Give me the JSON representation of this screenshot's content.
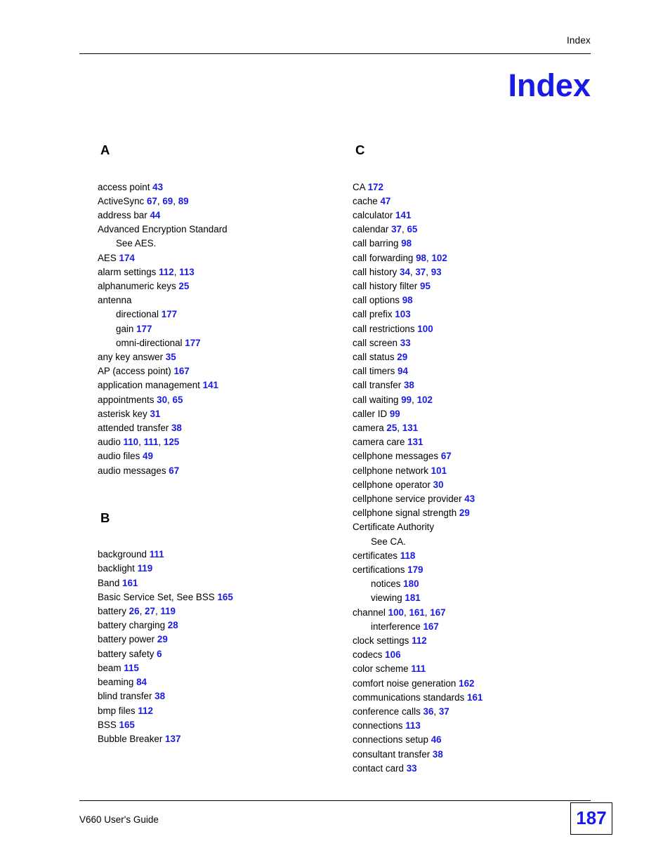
{
  "header": {
    "running_head": "Index"
  },
  "title": "Index",
  "footer": {
    "guide_name": "V660 User's Guide",
    "page_number": "187"
  },
  "columns": [
    {
      "sections": [
        {
          "letter": "A",
          "entries": [
            {
              "text": "access point",
              "pages": [
                "43"
              ],
              "sub": false
            },
            {
              "text": "ActiveSync",
              "pages": [
                "67",
                "69",
                "89"
              ],
              "sub": false
            },
            {
              "text": "address bar",
              "pages": [
                "44"
              ],
              "sub": false
            },
            {
              "text": "Advanced Encryption Standard",
              "pages": [],
              "sub": false
            },
            {
              "text": "See AES.",
              "pages": [],
              "sub": true
            },
            {
              "text": "AES",
              "pages": [
                "174"
              ],
              "sub": false
            },
            {
              "text": "alarm settings",
              "pages": [
                "112",
                "113"
              ],
              "sub": false
            },
            {
              "text": "alphanumeric keys",
              "pages": [
                "25"
              ],
              "sub": false
            },
            {
              "text": "antenna",
              "pages": [],
              "sub": false
            },
            {
              "text": "directional",
              "pages": [
                "177"
              ],
              "sub": true
            },
            {
              "text": "gain",
              "pages": [
                "177"
              ],
              "sub": true
            },
            {
              "text": "omni-directional",
              "pages": [
                "177"
              ],
              "sub": true
            },
            {
              "text": "any key answer",
              "pages": [
                "35"
              ],
              "sub": false
            },
            {
              "text": "AP (access point)",
              "pages": [
                "167"
              ],
              "sub": false
            },
            {
              "text": "application management",
              "pages": [
                "141"
              ],
              "sub": false
            },
            {
              "text": "appointments",
              "pages": [
                "30",
                "65"
              ],
              "sub": false
            },
            {
              "text": "asterisk key",
              "pages": [
                "31"
              ],
              "sub": false
            },
            {
              "text": "attended transfer",
              "pages": [
                "38"
              ],
              "sub": false
            },
            {
              "text": "audio",
              "pages": [
                "110",
                "111",
                "125"
              ],
              "sub": false
            },
            {
              "text": "audio files",
              "pages": [
                "49"
              ],
              "sub": false
            },
            {
              "text": "audio messages",
              "pages": [
                "67"
              ],
              "sub": false
            }
          ]
        },
        {
          "letter": "B",
          "entries": [
            {
              "text": "background",
              "pages": [
                "111"
              ],
              "sub": false
            },
            {
              "text": "backlight",
              "pages": [
                "119"
              ],
              "sub": false
            },
            {
              "text": "Band",
              "pages": [
                "161"
              ],
              "sub": false
            },
            {
              "text": "Basic Service Set, See BSS",
              "pages": [
                "165"
              ],
              "sub": false
            },
            {
              "text": "battery",
              "pages": [
                "26",
                "27",
                "119"
              ],
              "sub": false
            },
            {
              "text": "battery charging",
              "pages": [
                "28"
              ],
              "sub": false
            },
            {
              "text": "battery power",
              "pages": [
                "29"
              ],
              "sub": false
            },
            {
              "text": "battery safety",
              "pages": [
                "6"
              ],
              "sub": false
            },
            {
              "text": "beam",
              "pages": [
                "115"
              ],
              "sub": false
            },
            {
              "text": "beaming",
              "pages": [
                "84"
              ],
              "sub": false
            },
            {
              "text": "blind transfer",
              "pages": [
                "38"
              ],
              "sub": false
            },
            {
              "text": "bmp files",
              "pages": [
                "112"
              ],
              "sub": false
            },
            {
              "text": "BSS",
              "pages": [
                "165"
              ],
              "sub": false
            },
            {
              "text": "Bubble Breaker",
              "pages": [
                "137"
              ],
              "sub": false
            }
          ]
        }
      ]
    },
    {
      "sections": [
        {
          "letter": "C",
          "entries": [
            {
              "text": "CA",
              "pages": [
                "172"
              ],
              "sub": false
            },
            {
              "text": "cache",
              "pages": [
                "47"
              ],
              "sub": false
            },
            {
              "text": "calculator",
              "pages": [
                "141"
              ],
              "sub": false
            },
            {
              "text": "calendar",
              "pages": [
                "37",
                "65"
              ],
              "sub": false
            },
            {
              "text": "call barring",
              "pages": [
                "98"
              ],
              "sub": false
            },
            {
              "text": "call forwarding",
              "pages": [
                "98",
                "102"
              ],
              "sub": false
            },
            {
              "text": "call history",
              "pages": [
                "34",
                "37",
                "93"
              ],
              "sub": false
            },
            {
              "text": "call history filter",
              "pages": [
                "95"
              ],
              "sub": false
            },
            {
              "text": "call options",
              "pages": [
                "98"
              ],
              "sub": false
            },
            {
              "text": "call prefix",
              "pages": [
                "103"
              ],
              "sub": false
            },
            {
              "text": "call restrictions",
              "pages": [
                "100"
              ],
              "sub": false
            },
            {
              "text": "call screen",
              "pages": [
                "33"
              ],
              "sub": false
            },
            {
              "text": "call status",
              "pages": [
                "29"
              ],
              "sub": false
            },
            {
              "text": "call timers",
              "pages": [
                "94"
              ],
              "sub": false
            },
            {
              "text": "call transfer",
              "pages": [
                "38"
              ],
              "sub": false
            },
            {
              "text": "call waiting",
              "pages": [
                "99",
                "102"
              ],
              "sub": false
            },
            {
              "text": "caller ID",
              "pages": [
                "99"
              ],
              "sub": false
            },
            {
              "text": "camera",
              "pages": [
                "25",
                "131"
              ],
              "sub": false
            },
            {
              "text": "camera care",
              "pages": [
                "131"
              ],
              "sub": false
            },
            {
              "text": "cellphone messages",
              "pages": [
                "67"
              ],
              "sub": false
            },
            {
              "text": "cellphone network",
              "pages": [
                "101"
              ],
              "sub": false
            },
            {
              "text": "cellphone operator",
              "pages": [
                "30"
              ],
              "sub": false
            },
            {
              "text": "cellphone service provider",
              "pages": [
                "43"
              ],
              "sub": false
            },
            {
              "text": "cellphone signal strength",
              "pages": [
                "29"
              ],
              "sub": false
            },
            {
              "text": "Certificate Authority",
              "pages": [],
              "sub": false
            },
            {
              "text": "See CA.",
              "pages": [],
              "sub": true
            },
            {
              "text": "certificates",
              "pages": [
                "118"
              ],
              "sub": false
            },
            {
              "text": "certifications",
              "pages": [
                "179"
              ],
              "sub": false
            },
            {
              "text": "notices",
              "pages": [
                "180"
              ],
              "sub": true
            },
            {
              "text": "viewing",
              "pages": [
                "181"
              ],
              "sub": true
            },
            {
              "text": "channel",
              "pages": [
                "100",
                "161",
                "167"
              ],
              "sub": false
            },
            {
              "text": "interference",
              "pages": [
                "167"
              ],
              "sub": true
            },
            {
              "text": "clock settings",
              "pages": [
                "112"
              ],
              "sub": false
            },
            {
              "text": "codecs",
              "pages": [
                "106"
              ],
              "sub": false
            },
            {
              "text": "color scheme",
              "pages": [
                "111"
              ],
              "sub": false
            },
            {
              "text": "comfort noise generation",
              "pages": [
                "162"
              ],
              "sub": false
            },
            {
              "text": "communications standards",
              "pages": [
                "161"
              ],
              "sub": false
            },
            {
              "text": "conference calls",
              "pages": [
                "36",
                "37"
              ],
              "sub": false
            },
            {
              "text": "connections",
              "pages": [
                "113"
              ],
              "sub": false
            },
            {
              "text": "connections setup",
              "pages": [
                "46"
              ],
              "sub": false
            },
            {
              "text": "consultant transfer",
              "pages": [
                "38"
              ],
              "sub": false
            },
            {
              "text": "contact card",
              "pages": [
                "33"
              ],
              "sub": false
            }
          ]
        }
      ]
    }
  ],
  "colors": {
    "accent": "#1a1ae6",
    "text": "#000000"
  }
}
